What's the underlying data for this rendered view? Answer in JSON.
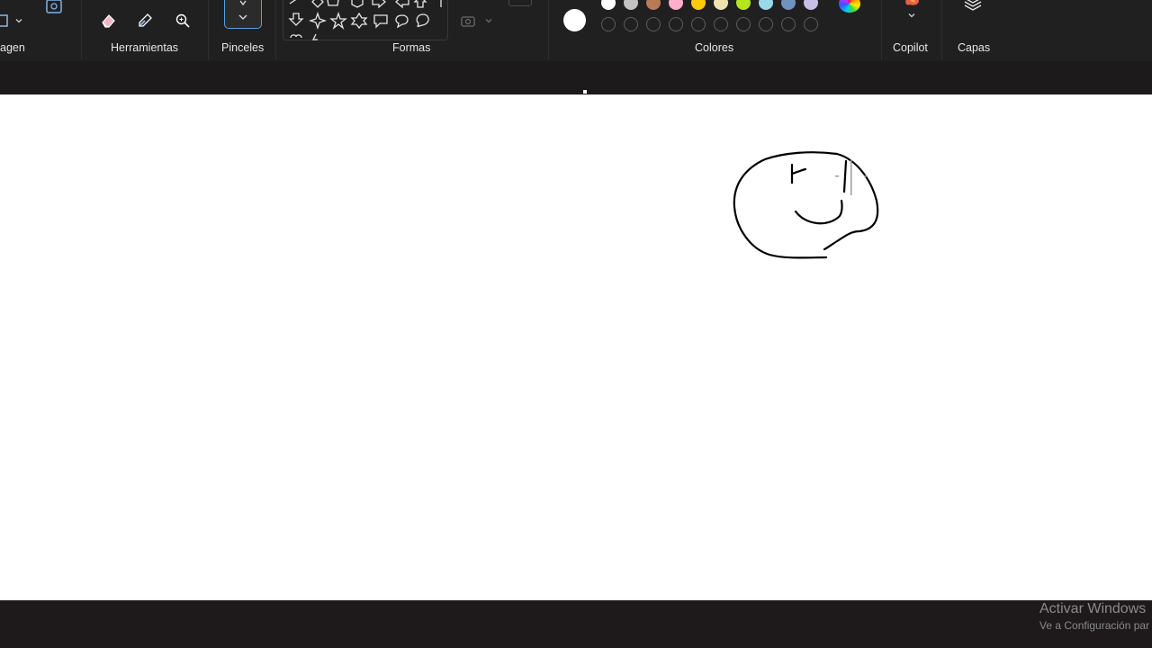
{
  "ribbon": {
    "groups": {
      "image_label": "agen",
      "tools_label": "Herramientas",
      "brushes_label": "Pinceles",
      "shapes_label": "Formas",
      "colors_label": "Colores",
      "copilot_label": "Copilot",
      "layers_label": "Capas"
    },
    "tools": [
      "eraser-icon",
      "color-picker-icon",
      "magnifier-icon"
    ],
    "shapes": [
      "line",
      "diamond",
      "pentagon",
      "hexagon",
      "right-arrow",
      "left-arrow",
      "up-arrow",
      "down-arrow",
      "four-point-star",
      "five-point-star",
      "six-point-star",
      "rectangular-callout",
      "oval-callout",
      "cloud-callout",
      "heart",
      "lightning"
    ],
    "colors": {
      "current": "#ffffff",
      "row1": [
        "#ffffff",
        "#c3c3c3",
        "#b97a57",
        "#ffaec9",
        "#ffc90e",
        "#efe4b0",
        "#b5e61d",
        "#99d9ea",
        "#7092be",
        "#c8bfe7"
      ],
      "row2_empty_count": 10
    }
  },
  "canvas": {
    "background": "#ffffff",
    "drawing": "smiley-face-sketch"
  },
  "watermark": {
    "line1": "Activar Windows",
    "line2": "Ve a Configuración par"
  }
}
